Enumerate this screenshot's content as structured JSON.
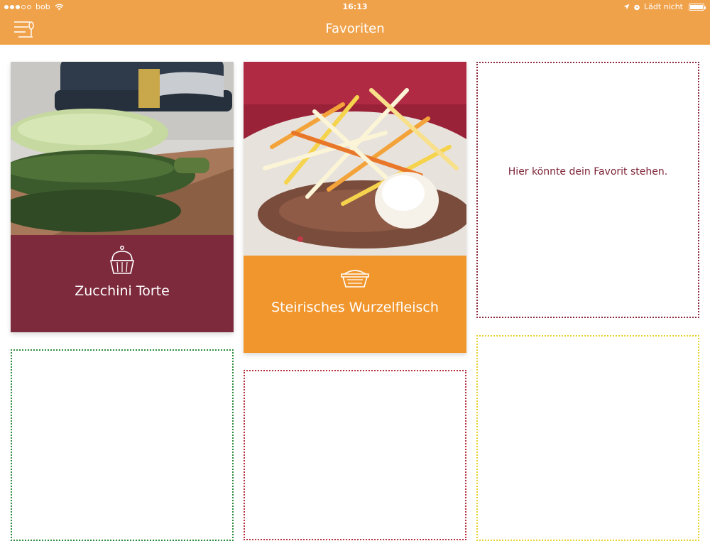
{
  "status_bar": {
    "carrier": "bob",
    "time": "16:13",
    "charging_text": "Lädt nicht",
    "signal_bars_filled": 3,
    "signal_bars_total": 5,
    "battery_level": 0.95
  },
  "navbar": {
    "title": "Favoriten",
    "background": "#f0a24a",
    "menu_icon": "menu-cutlery-icon"
  },
  "favorites": [
    {
      "name": "Zucchini Torte",
      "icon": "cake-icon",
      "color": "#7d2a3c"
    },
    {
      "name": "Steirisches Wurzelfleisch",
      "icon": "casserole-icon",
      "color": "#f0962d"
    }
  ],
  "empty_slots": {
    "placeholder_text": "Hier könnte dein Favorit stehen.",
    "colors": {
      "slot_top_right": "#8a2b3e",
      "slot_bottom_left": "#2e8b3e",
      "slot_bottom_middle": "#b5303b",
      "slot_bottom_right": "#e8d12a"
    }
  }
}
